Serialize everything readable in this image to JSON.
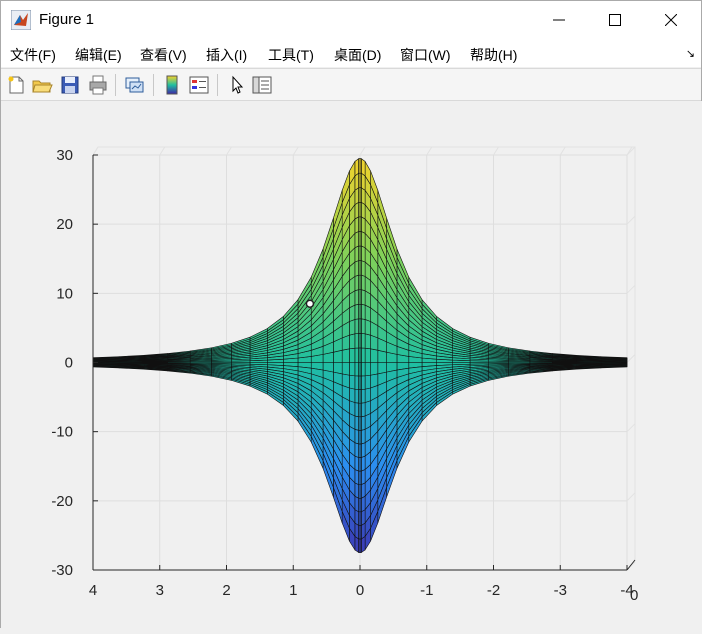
{
  "window": {
    "title": "Figure 1",
    "icon": "matlab-logo-icon",
    "controls": {
      "minimize": "minimize-icon",
      "maximize": "maximize-icon",
      "close": "close-icon"
    }
  },
  "menubar": {
    "items": [
      {
        "label": "文件(F)"
      },
      {
        "label": "编辑(E)"
      },
      {
        "label": "查看(V)"
      },
      {
        "label": "插入(I)"
      },
      {
        "label": "工具(T)"
      },
      {
        "label": "桌面(D)"
      },
      {
        "label": "窗口(W)"
      },
      {
        "label": "帮助(H)"
      }
    ],
    "dock_glyph": "↘"
  },
  "toolbar": {
    "buttons": [
      "new-figure-icon",
      "open-file-icon",
      "save-icon",
      "print-icon",
      "link-plot-icon",
      "colorbar-icon",
      "legend-icon",
      "pointer-icon",
      "property-inspector-icon"
    ]
  },
  "chart_data": {
    "type": "surface",
    "title": "",
    "xlabel": "",
    "ylabel": "",
    "zlabel": "",
    "x_ticks": [
      "4",
      "3",
      "2",
      "1",
      "0",
      "-1",
      "-2",
      "-3",
      "-4"
    ],
    "z_ticks": [
      "30",
      "20",
      "10",
      "0",
      "-10",
      "-20",
      "-30"
    ],
    "y_tick_visible": "0",
    "xlim": [
      -4,
      4
    ],
    "zlim": [
      -30,
      30
    ],
    "upper_peak": 29.5,
    "lower_peak": -27.5,
    "grid": true,
    "colormap": "parula",
    "colors": {
      "low": "#3e26a8",
      "mid_low": "#2c8ef0",
      "mid": "#1fbfa0",
      "mid_high": "#7fd15a",
      "high": "#f9d32a"
    },
    "marker": {
      "x": 0.75,
      "z": 8.5
    }
  }
}
